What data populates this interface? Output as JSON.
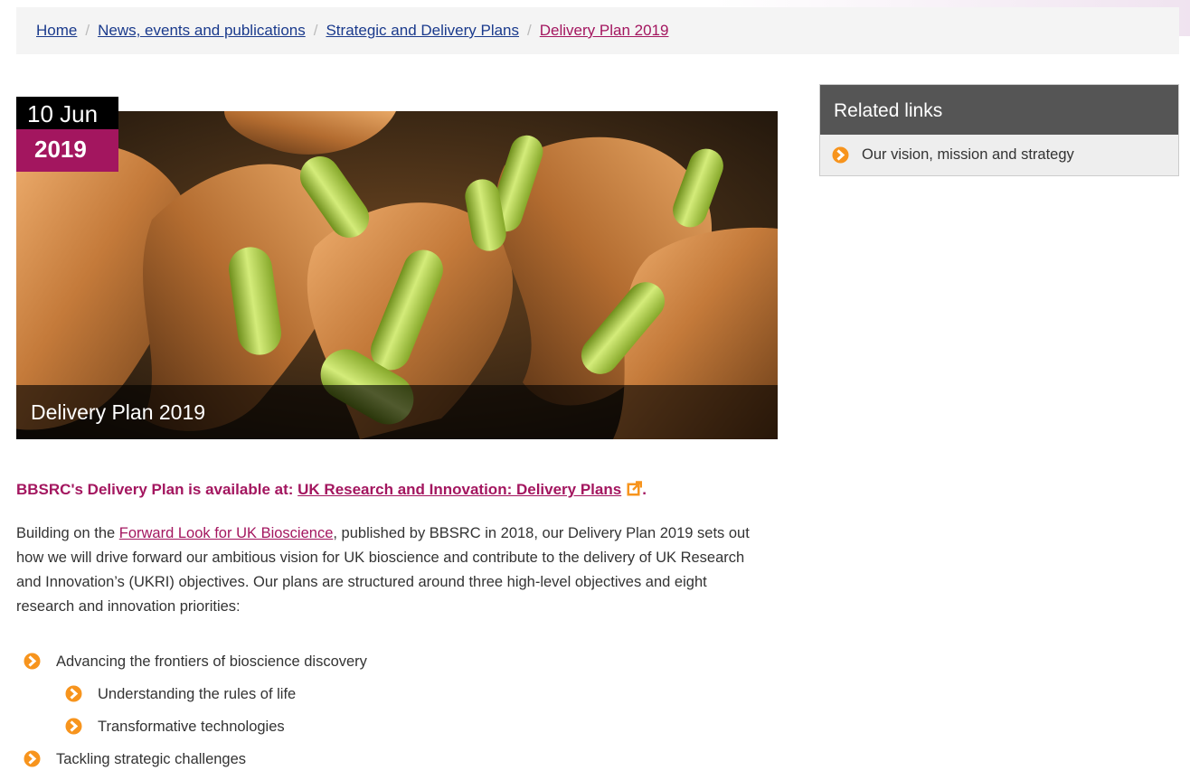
{
  "breadcrumb": {
    "items": [
      {
        "label": "Home"
      },
      {
        "label": "News, events and publications"
      },
      {
        "label": "Strategic and Delivery Plans"
      },
      {
        "label": "Delivery Plan 2019"
      }
    ],
    "separator": "/"
  },
  "article": {
    "date_day": "10 Jun",
    "date_year": "2019",
    "hero_caption": "Delivery Plan 2019",
    "lead_prefix": "BBSRC's Delivery Plan is available at:",
    "lead_link": "UK Research and Innovation: Delivery Plans",
    "lead_suffix": ".",
    "body_before_link": "Building on the",
    "body_link": "Forward Look for UK Bioscience",
    "body_after_link": ", published by BBSRC in 2018, our Delivery Plan 2019 sets out how we will drive forward our ambitious vision for UK bioscience and contribute to the delivery of UK Research and Innovation’s (UKRI) objectives. Our plans are structured around three high-level objectives and eight research and innovation priorities:",
    "bullets": [
      {
        "label": "Advancing the frontiers of bioscience discovery"
      },
      {
        "label": "Understanding the rules of life"
      },
      {
        "label": "Transformative technologies"
      },
      {
        "label": "Tackling strategic challenges"
      }
    ]
  },
  "related_links": {
    "heading": "Related links",
    "items": [
      {
        "label": "Our vision, mission and strategy"
      }
    ]
  },
  "colors": {
    "accent": "#a3165f",
    "link": "#1a3a8c",
    "bullet": "#f7941d",
    "panel_header": "#555555"
  },
  "icons": {
    "bullet": "orange-circle-arrow-icon",
    "external": "external-link-icon"
  }
}
